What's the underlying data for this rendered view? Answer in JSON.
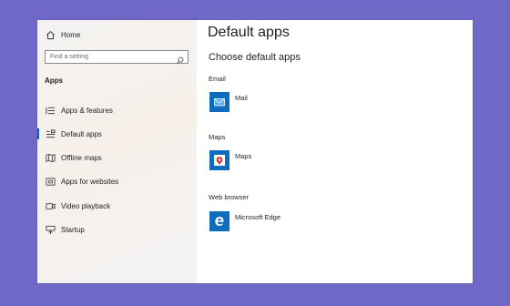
{
  "sidebar": {
    "home_label": "Home",
    "search_placeholder": "Find a setting",
    "section_heading": "Apps",
    "items": [
      {
        "label": "Apps & features",
        "icon": "list-icon"
      },
      {
        "label": "Default apps",
        "icon": "default-apps-icon",
        "selected": true
      },
      {
        "label": "Offline maps",
        "icon": "map-icon"
      },
      {
        "label": "Apps for websites",
        "icon": "website-icon"
      },
      {
        "label": "Video playback",
        "icon": "video-icon"
      },
      {
        "label": "Startup",
        "icon": "startup-icon"
      }
    ]
  },
  "main": {
    "title": "Default apps",
    "subtitle": "Choose default apps",
    "groups": [
      {
        "label": "Email",
        "app": "Mail",
        "icon": "mail-icon",
        "tile_color": "#0f6cbd"
      },
      {
        "label": "Maps",
        "app": "Maps",
        "icon": "maps-icon",
        "tile_color": "#0f6cbd"
      },
      {
        "label": "Web browser",
        "app": "Microsoft Edge",
        "icon": "edge-icon",
        "tile_color": "#0f6cbd"
      }
    ]
  },
  "colors": {
    "accent": "#0067c0",
    "background": "#7068c6"
  }
}
